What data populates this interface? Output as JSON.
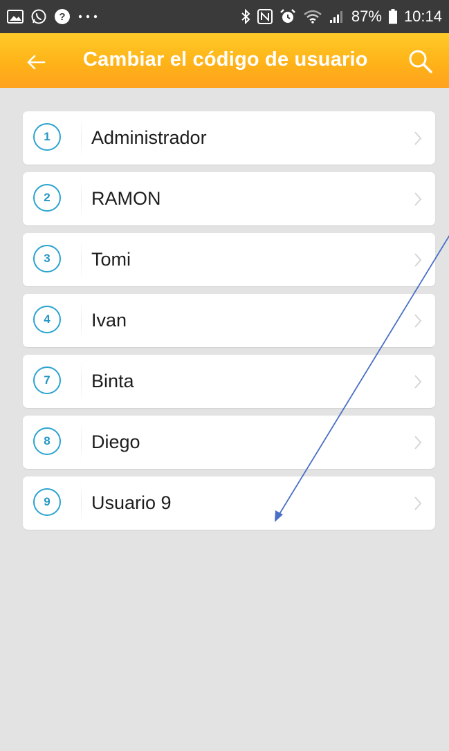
{
  "status_bar": {
    "left_icons": [
      "gallery-icon",
      "whatsapp-icon",
      "help-icon",
      "more-dots-icon"
    ],
    "right_icons": [
      "bluetooth-icon",
      "nfc-icon",
      "alarm-icon",
      "wifi-icon",
      "signal-icon"
    ],
    "battery": "87%",
    "time": "10:14"
  },
  "app_bar": {
    "title": "Cambiar el código de usuario",
    "back_icon": "arrow-left-icon",
    "search_icon": "search-icon",
    "background": "#ffb318",
    "text_color": "#ffffff"
  },
  "users": [
    {
      "number": "1",
      "name": "Administrador"
    },
    {
      "number": "2",
      "name": "RAMON"
    },
    {
      "number": "3",
      "name": "Tomi"
    },
    {
      "number": "4",
      "name": "Ivan"
    },
    {
      "number": "7",
      "name": "Binta"
    },
    {
      "number": "8",
      "name": "Diego"
    },
    {
      "number": "9",
      "name": "Usuario 9"
    }
  ],
  "colors": {
    "accent": "#2aa3d0",
    "page_background": "#e3e3e3",
    "annotation_arrow": "#4a6fc7"
  }
}
